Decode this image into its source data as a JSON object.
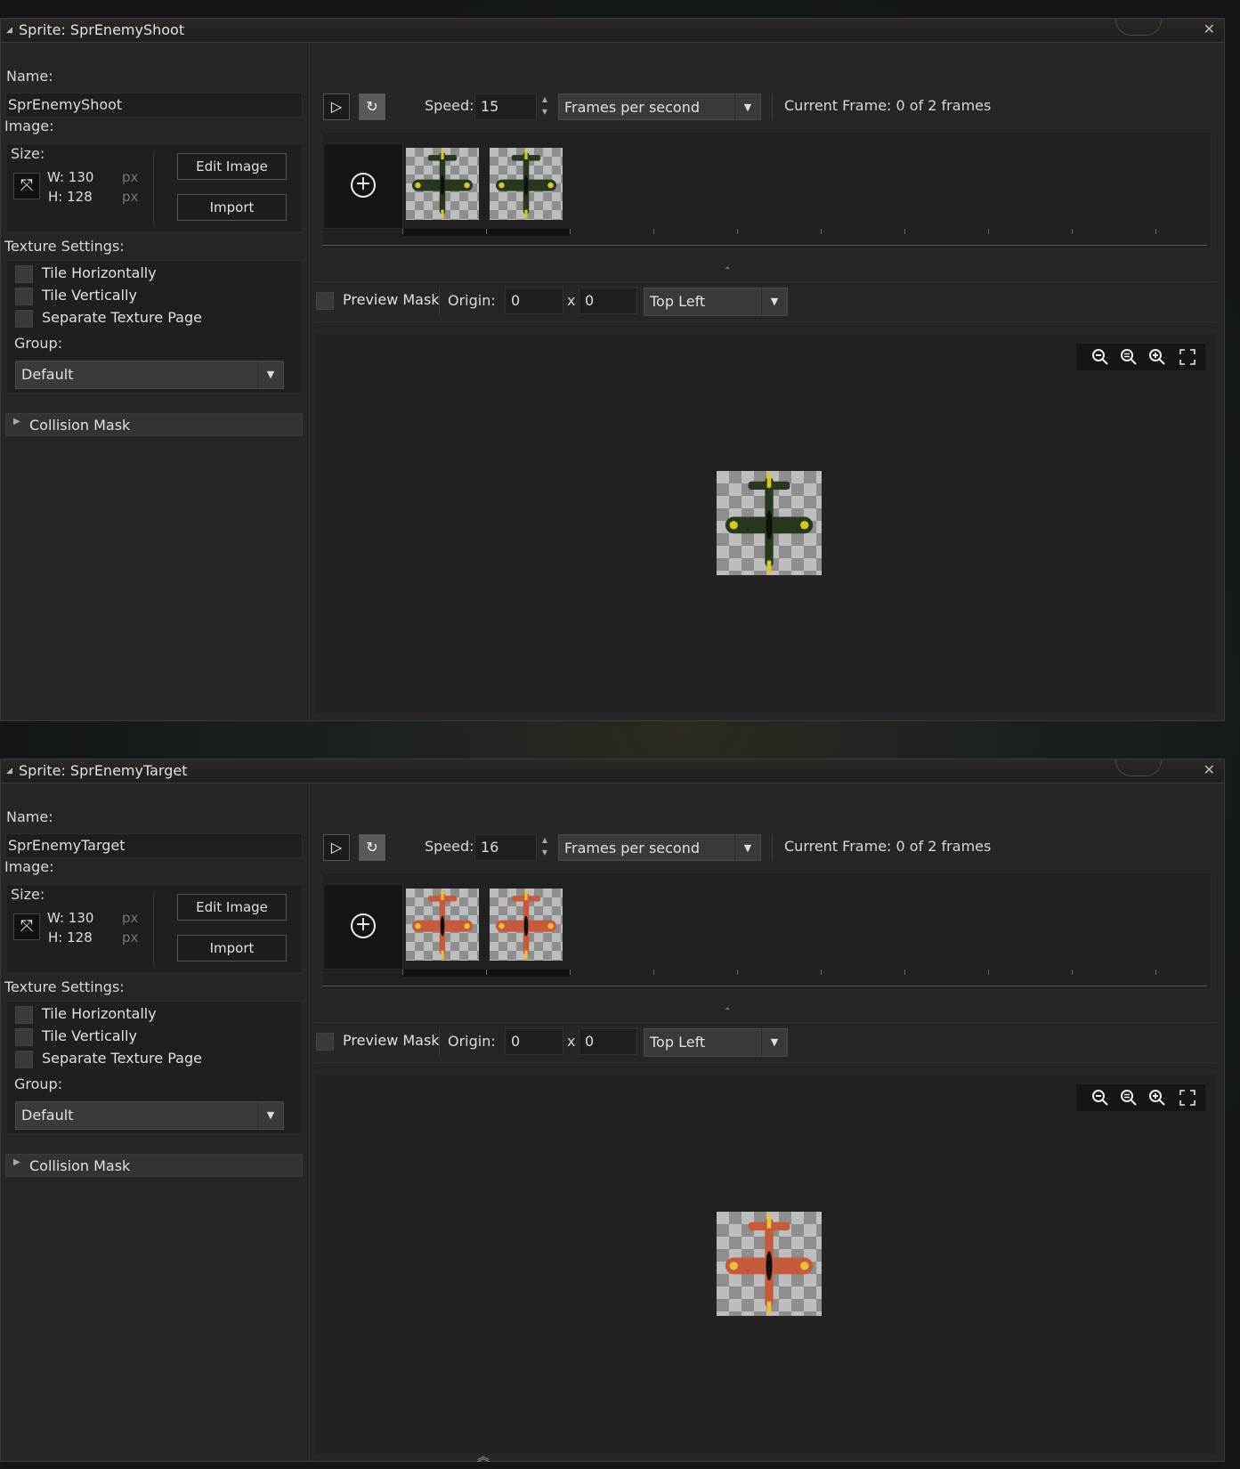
{
  "windows": [
    {
      "title": "Sprite: SprEnemyShoot",
      "name_label": "Name:",
      "name_value": "SprEnemyShoot",
      "image_label": "Image:",
      "size_label": "Size:",
      "width": "W: 130",
      "height": "H: 128",
      "unit": "px",
      "edit_image": "Edit Image",
      "import": "Import",
      "texture_label": "Texture Settings:",
      "tile_h": "Tile Horizontally",
      "tile_v": "Tile Vertically",
      "separate_page": "Separate Texture Page",
      "group_label": "Group:",
      "group_value": "Default",
      "collision_mask": "Collision Mask",
      "speed_label": "Speed:",
      "speed_value": "15",
      "speed_unit": "Frames per second",
      "current_frame": "Current Frame: 0 of 2 frames",
      "preview_mask": "Preview Mask",
      "origin_label": "Origin:",
      "origin_x": "0",
      "origin_sep": "x",
      "origin_y": "0",
      "origin_preset": "Top Left",
      "plane_body": "#27381f",
      "plane_accent": "#d8c825"
    },
    {
      "title": "Sprite: SprEnemyTarget",
      "name_label": "Name:",
      "name_value": "SprEnemyTarget",
      "image_label": "Image:",
      "size_label": "Size:",
      "width": "W: 130",
      "height": "H: 128",
      "unit": "px",
      "edit_image": "Edit Image",
      "import": "Import",
      "texture_label": "Texture Settings:",
      "tile_h": "Tile Horizontally",
      "tile_v": "Tile Vertically",
      "separate_page": "Separate Texture Page",
      "group_label": "Group:",
      "group_value": "Default",
      "collision_mask": "Collision Mask",
      "speed_label": "Speed:",
      "speed_value": "16",
      "speed_unit": "Frames per second",
      "current_frame": "Current Frame: 0 of 2 frames",
      "preview_mask": "Preview Mask",
      "origin_label": "Origin:",
      "origin_x": "0",
      "origin_sep": "x",
      "origin_y": "0",
      "origin_preset": "Top Left",
      "plane_body": "#c85a3c",
      "plane_accent": "#e8c23a"
    }
  ]
}
